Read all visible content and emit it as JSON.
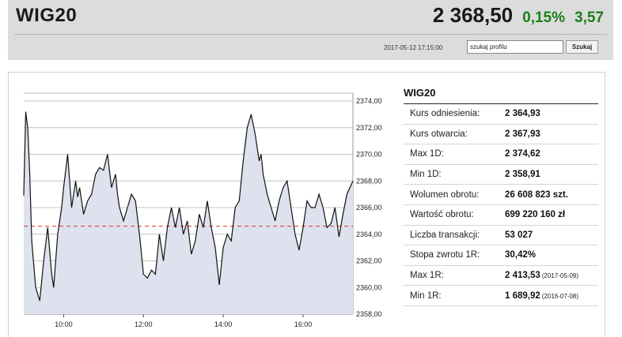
{
  "header": {
    "ticker": "WIG20",
    "price": "2 368,50",
    "change_pct": "0,15%",
    "change_abs": "3,57",
    "timestamp": "2017-05-12 17:15:00",
    "search_value": "szukaj profilu",
    "search_button": "Szukaj",
    "positive_color": "#1a7f1a"
  },
  "stats": {
    "title": "WIG20",
    "rows": [
      {
        "label": "Kurs odniesienia:",
        "value": "2 364,93",
        "date": ""
      },
      {
        "label": "Kurs otwarcia:",
        "value": "2 367,93",
        "date": ""
      },
      {
        "label": "Max 1D:",
        "value": "2 374,62",
        "date": ""
      },
      {
        "label": "Min 1D:",
        "value": "2 358,91",
        "date": ""
      },
      {
        "label": "Wolumen obrotu:",
        "value": "26 608 823 szt.",
        "date": ""
      },
      {
        "label": "Wartość obrotu:",
        "value": "699 220 160 zł",
        "date": ""
      },
      {
        "label": "Liczba transakcji:",
        "value": "53 027",
        "date": ""
      },
      {
        "label": "Stopa zwrotu 1R:",
        "value": "30,42%",
        "date": ""
      },
      {
        "label": "Max 1R:",
        "value": "2 413,53",
        "date": "(2017-05-09)"
      },
      {
        "label": "Min 1R:",
        "value": "1 689,92",
        "date": "(2016-07-08)"
      }
    ]
  },
  "chart_data": {
    "type": "area",
    "title": "",
    "xlabel": "",
    "ylabel": "",
    "xlim": [
      9.0,
      17.25
    ],
    "ylim": [
      2358.0,
      2374.0
    ],
    "x_ticks": [
      10,
      12,
      14,
      16
    ],
    "x_tick_labels": [
      "10:00",
      "12:00",
      "14:00",
      "16:00"
    ],
    "y_ticks": [
      2358,
      2360,
      2362,
      2364,
      2366,
      2368,
      2370,
      2372,
      2374
    ],
    "y_tick_labels": [
      "2358,00",
      "2360,00",
      "2362,00",
      "2364,00",
      "2366,00",
      "2368,00",
      "2370,00",
      "2372,00",
      "2374,00"
    ],
    "reference_line": 2364.6,
    "grid": true,
    "line_color": "#111111",
    "fill_color": "#dde2ee",
    "reference_color": "#e03030",
    "x": [
      9.0,
      9.05,
      9.1,
      9.15,
      9.2,
      9.3,
      9.4,
      9.5,
      9.6,
      9.7,
      9.75,
      9.85,
      9.95,
      10.0,
      10.1,
      10.2,
      10.3,
      10.35,
      10.4,
      10.5,
      10.6,
      10.7,
      10.8,
      10.9,
      11.0,
      11.1,
      11.2,
      11.3,
      11.35,
      11.4,
      11.5,
      11.6,
      11.7,
      11.8,
      11.9,
      12.0,
      12.1,
      12.2,
      12.3,
      12.4,
      12.5,
      12.6,
      12.7,
      12.8,
      12.9,
      13.0,
      13.1,
      13.2,
      13.3,
      13.4,
      13.5,
      13.6,
      13.7,
      13.8,
      13.9,
      14.0,
      14.1,
      14.2,
      14.3,
      14.4,
      14.5,
      14.6,
      14.7,
      14.8,
      14.9,
      14.95,
      15.0,
      15.1,
      15.2,
      15.3,
      15.4,
      15.5,
      15.6,
      15.7,
      15.8,
      15.9,
      16.0,
      16.1,
      16.2,
      16.3,
      16.4,
      16.5,
      16.6,
      16.7,
      16.8,
      16.9,
      17.0,
      17.1,
      17.25
    ],
    "y": [
      2366.9,
      2373.2,
      2372.0,
      2368.5,
      2363.5,
      2360.0,
      2359.0,
      2362.0,
      2364.5,
      2361.0,
      2360.0,
      2364.0,
      2366.0,
      2367.5,
      2370.0,
      2366.0,
      2368.0,
      2366.8,
      2367.5,
      2365.5,
      2366.5,
      2367.0,
      2368.5,
      2369.0,
      2368.8,
      2370.0,
      2367.5,
      2368.5,
      2367.0,
      2366.0,
      2365.0,
      2366.0,
      2367.0,
      2366.5,
      2364.0,
      2361.0,
      2360.7,
      2361.3,
      2361.0,
      2364.0,
      2362.0,
      2364.5,
      2366.0,
      2364.5,
      2366.0,
      2364.0,
      2365.0,
      2362.5,
      2363.5,
      2365.5,
      2364.5,
      2366.5,
      2364.5,
      2363.0,
      2360.2,
      2363.0,
      2364.0,
      2363.5,
      2366.0,
      2366.5,
      2369.5,
      2372.0,
      2373.0,
      2371.5,
      2369.5,
      2370.0,
      2368.5,
      2367.0,
      2366.0,
      2365.0,
      2366.5,
      2367.5,
      2368.0,
      2366.0,
      2364.0,
      2362.8,
      2364.5,
      2366.5,
      2366.0,
      2366.0,
      2367.0,
      2366.0,
      2364.5,
      2364.8,
      2366.0,
      2363.8,
      2365.5,
      2367.0,
      2368.0
    ]
  }
}
